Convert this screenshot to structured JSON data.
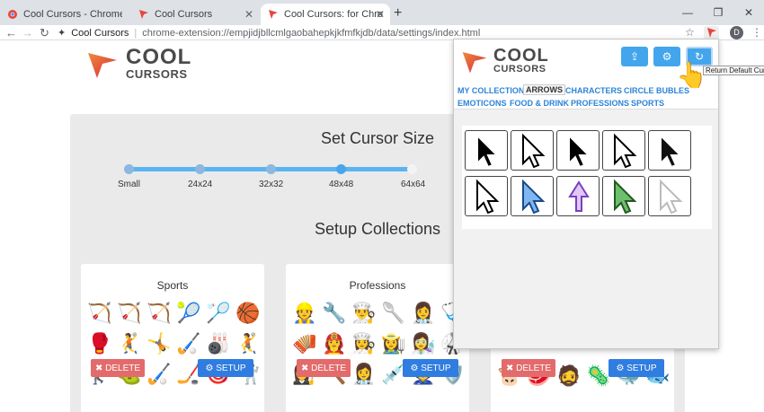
{
  "browser": {
    "tabs": [
      {
        "title": "Cool Cursors - Chrome Web Store",
        "active": false
      },
      {
        "title": "Cool Cursors",
        "active": false
      },
      {
        "title": "Cool Cursors: for Chrome™",
        "active": true
      }
    ],
    "new_tab": "+",
    "window_controls": [
      "—",
      "❐",
      "✕"
    ],
    "omnibox": {
      "site_name": "Cool Cursors",
      "url": "chrome-extension://empjidjbllcmlgaobahepkjkfmfkjdb/data/settings/index.html"
    },
    "avatar_letter": "D"
  },
  "logo": {
    "line1": "COOL",
    "line2": "CURSORS"
  },
  "settings": {
    "size_title": "Set Cursor Size",
    "sizes": [
      "Small",
      "24x24",
      "32x32",
      "48x48",
      "64x64"
    ],
    "selected_size": "48x48",
    "collections_title": "Setup Collections",
    "collections": [
      {
        "title": "Sports",
        "emojis": [
          "🏹",
          "🏹",
          "🏹",
          "🎾",
          "🏸",
          "🏀",
          "🥊",
          "🤾",
          "🤸",
          "🏑",
          "🎳",
          "🤾",
          "🏌",
          "⛳",
          "🏑",
          "🏒",
          "🎯",
          "🤺"
        ],
        "delete_label": "DELETE",
        "setup_label": "SETUP"
      },
      {
        "title": "Professions",
        "emojis": [
          "👷",
          "🔧",
          "👨‍🍳",
          "🥄",
          "👩‍⚕️",
          "🩺",
          "🪗",
          "👩‍🚒",
          "👩‍🍳",
          "👩‍🌾",
          "👩‍🔬",
          "🥋",
          "👩‍⚖️",
          "🔨",
          "👩‍⚕️",
          "💉",
          "👮",
          "🛡️"
        ],
        "delete_label": "DELETE",
        "setup_label": "SETUP"
      },
      {
        "title": "",
        "emojis": [
          "🐮",
          "🥩",
          "🧔",
          "🦠",
          "🐳",
          "🐟"
        ],
        "delete_label": "DELETE",
        "setup_label": "SETUP"
      }
    ]
  },
  "popup": {
    "logo": {
      "line1": "COOL",
      "line2": "CURSORS"
    },
    "buttons": [
      {
        "icon": "upload-icon",
        "glyph": "⇪"
      },
      {
        "icon": "gears-icon",
        "glyph": "⚙"
      },
      {
        "icon": "undo-icon",
        "glyph": "↻"
      }
    ],
    "tooltip": "Return Default Cursor",
    "tabs_row1": [
      "MY COLLECTION",
      "ARROWS",
      "CHARACTERS",
      "CIRCLE BUBLES"
    ],
    "tabs_row2": [
      "EMOTICONS",
      "FOOD & DRINK",
      "PROFESSIONS",
      "SPORTS"
    ],
    "selected_tab": "ARROWS",
    "cursors": [
      {
        "style": "black-bold",
        "fill": "#000000",
        "stroke": "#ffffff"
      },
      {
        "style": "white-outline",
        "fill": "#ffffff",
        "stroke": "#000000"
      },
      {
        "style": "black-classic",
        "fill": "#000000",
        "stroke": "#ffffff"
      },
      {
        "style": "white-small",
        "fill": "#ffffff",
        "stroke": "#000000"
      },
      {
        "style": "black-thin",
        "fill": "#111111",
        "stroke": "#ffffff"
      },
      {
        "style": "half-black",
        "fill": "#ffffff",
        "stroke": "#000000"
      },
      {
        "style": "blue-sparkle",
        "fill": "#7fb8f0",
        "stroke": "#1a4a8a"
      },
      {
        "style": "purple-up",
        "fill": "#e0c8f4",
        "stroke": "#7a3fc2"
      },
      {
        "style": "green",
        "fill": "#6fbe6f",
        "stroke": "#1f5a1f"
      },
      {
        "style": "light-grey",
        "fill": "#ffffff",
        "stroke": "#bbbbbb"
      }
    ]
  },
  "colors": {
    "accent": "#43a6ec",
    "slider": "#5ab4f0",
    "delete": "#e36b6b",
    "setup": "#2f7de1",
    "logo_red": "#e8453c"
  }
}
